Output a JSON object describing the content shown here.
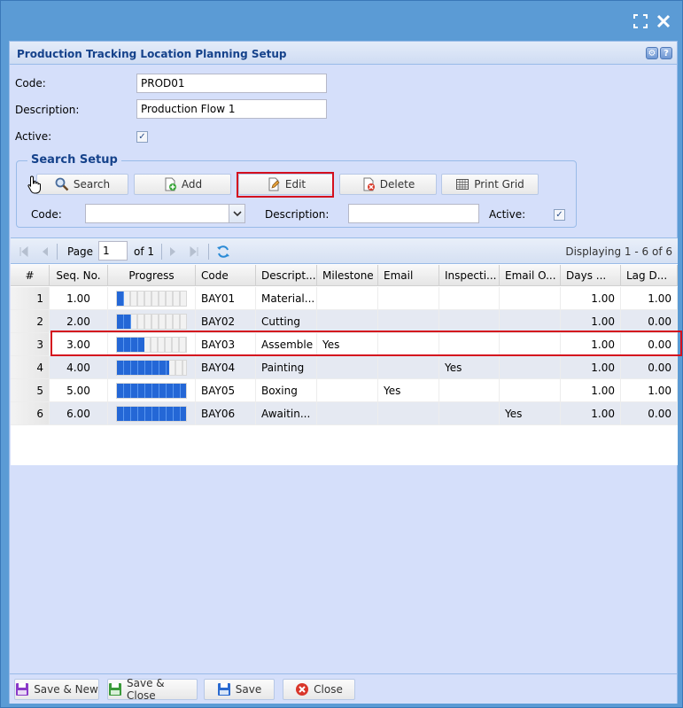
{
  "panel": {
    "title": "Production Tracking Location Planning Setup"
  },
  "form": {
    "code_label": "Code:",
    "code_value": "PROD01",
    "description_label": "Description:",
    "description_value": "Production Flow 1",
    "active_label": "Active:",
    "active_checked": true
  },
  "search_setup": {
    "legend": "Search Setup",
    "buttons": {
      "search": "Search",
      "add": "Add",
      "edit": "Edit",
      "delete": "Delete",
      "print_grid": "Print Grid"
    },
    "code_label": "Code:",
    "code_value": "",
    "description_label": "Description:",
    "description_value": "",
    "active_label": "Active:",
    "active_checked": true
  },
  "pager": {
    "page_label": "Page",
    "page_value": "1",
    "of_label": "of 1",
    "displaying": "Displaying 1 - 6 of 6"
  },
  "grid": {
    "columns": [
      "#",
      "Seq. No.",
      "Progress",
      "Code",
      "Descript...",
      "Milestone",
      "Email",
      "Inspecti...",
      "Email O...",
      "Days ...",
      "Lag D..."
    ],
    "rows": [
      {
        "num": "1",
        "seq": "1.00",
        "progress": 0.1,
        "code": "BAY01",
        "desc": "Material...",
        "milestone": "",
        "email": "",
        "inspection": "",
        "email_o": "",
        "days": "1.00",
        "lag": "1.00"
      },
      {
        "num": "2",
        "seq": "2.00",
        "progress": 0.2,
        "code": "BAY02",
        "desc": "Cutting",
        "milestone": "",
        "email": "",
        "inspection": "",
        "email_o": "",
        "days": "1.00",
        "lag": "0.00"
      },
      {
        "num": "3",
        "seq": "3.00",
        "progress": 0.4,
        "code": "BAY03",
        "desc": "Assemble",
        "milestone": "Yes",
        "email": "",
        "inspection": "",
        "email_o": "",
        "days": "1.00",
        "lag": "0.00"
      },
      {
        "num": "4",
        "seq": "4.00",
        "progress": 0.75,
        "code": "BAY04",
        "desc": "Painting",
        "milestone": "",
        "email": "",
        "inspection": "Yes",
        "email_o": "",
        "days": "1.00",
        "lag": "0.00"
      },
      {
        "num": "5",
        "seq": "5.00",
        "progress": 1.0,
        "code": "BAY05",
        "desc": "Boxing",
        "milestone": "",
        "email": "Yes",
        "inspection": "",
        "email_o": "",
        "days": "1.00",
        "lag": "1.00"
      },
      {
        "num": "6",
        "seq": "6.00",
        "progress": 1.0,
        "code": "BAY06",
        "desc": "Awaitin...",
        "milestone": "",
        "email": "",
        "inspection": "",
        "email_o": "Yes",
        "days": "1.00",
        "lag": "0.00"
      }
    ]
  },
  "footer": {
    "save_new": "Save & New",
    "save_close": "Save & Close",
    "save": "Save",
    "close": "Close"
  },
  "colors": {
    "accent": "#15428b",
    "highlight": "#d40f1e",
    "progress": "#2467d6"
  }
}
